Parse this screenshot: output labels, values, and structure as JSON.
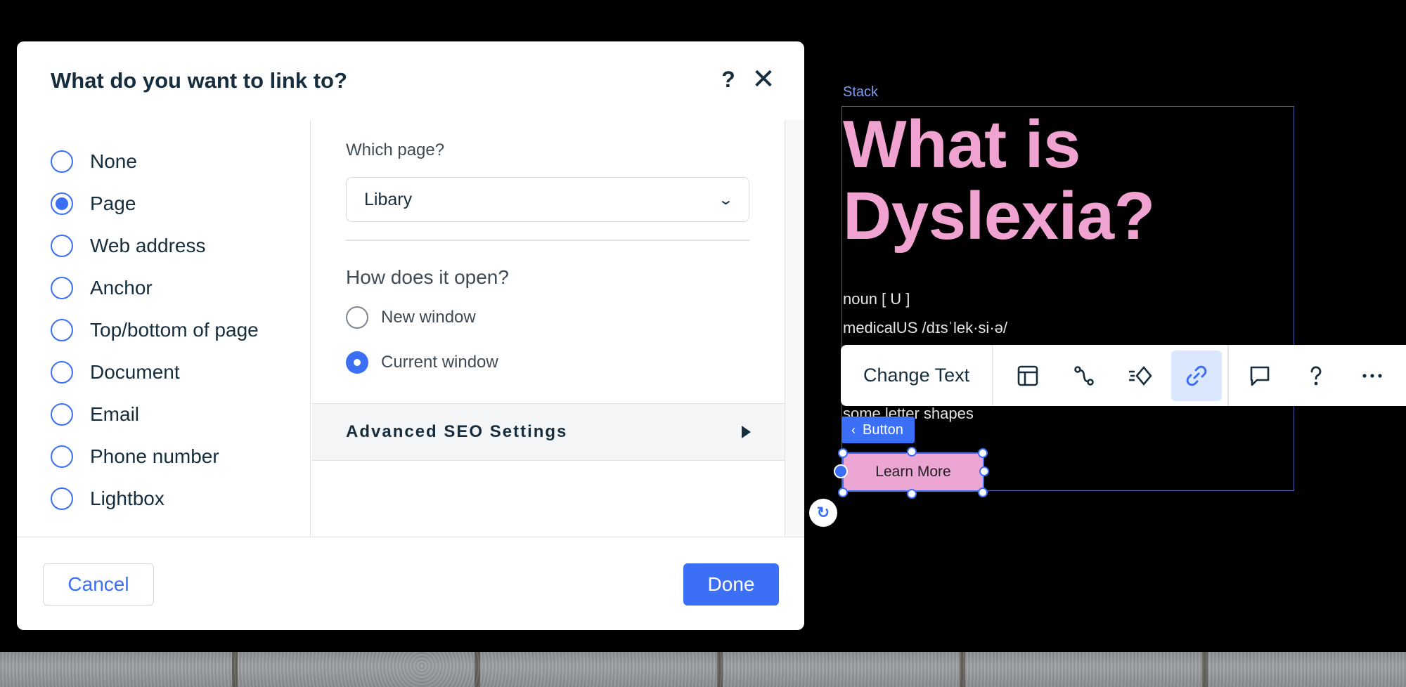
{
  "dialog": {
    "title": "What do you want to link to?",
    "help_label": "?",
    "close_label": "✕",
    "link_types": [
      {
        "label": "None",
        "checked": false
      },
      {
        "label": "Page",
        "checked": true
      },
      {
        "label": "Web address",
        "checked": false
      },
      {
        "label": "Anchor",
        "checked": false
      },
      {
        "label": "Top/bottom of page",
        "checked": false
      },
      {
        "label": "Document",
        "checked": false
      },
      {
        "label": "Email",
        "checked": false
      },
      {
        "label": "Phone number",
        "checked": false
      },
      {
        "label": "Lightbox",
        "checked": false
      }
    ],
    "page_section": {
      "label": "Which page?",
      "selected_page": "Libary"
    },
    "open_section": {
      "heading": "How does it open?",
      "options": [
        {
          "label": "New window",
          "checked": false
        },
        {
          "label": "Current window",
          "checked": true
        }
      ]
    },
    "seo_label": "Advanced SEO Settings",
    "cancel_label": "Cancel",
    "done_label": "Done"
  },
  "canvas": {
    "stack_label": "Stack",
    "hero_title": "What is Dyslexia?",
    "definition_lines": [
      "noun [ U ]",
      "medicalUS  /dɪsˈlek·si·ə/",
      "some letter shapes"
    ],
    "element_tag": "Button",
    "learn_more_label": "Learn More",
    "accent_color": "#3b6ff5",
    "title_color": "#f0a3d0"
  },
  "toolbar": {
    "change_text_label": "Change Text",
    "icons": [
      "layout-icon",
      "connect-icon",
      "animation-icon",
      "link-icon",
      "comment-icon",
      "help-icon",
      "more-icon"
    ],
    "active_icon": "link-icon"
  }
}
